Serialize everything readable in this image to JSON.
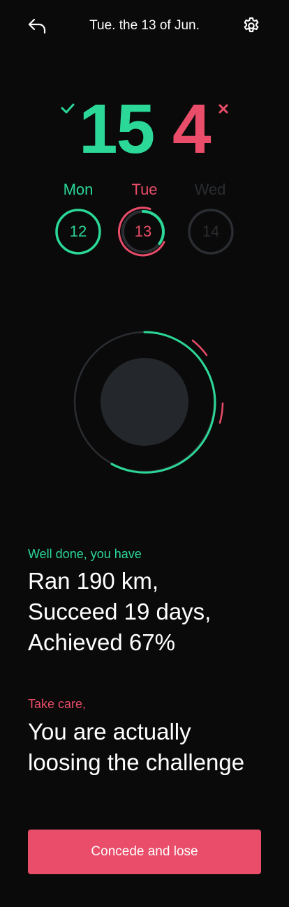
{
  "header": {
    "title": "Tue. the 13 of Jun.",
    "back_icon": "undo-arrow-icon",
    "settings_icon": "gear-icon"
  },
  "score": {
    "success_count": "15",
    "fail_count": "4",
    "success_icon": "check-icon",
    "fail_icon": "close-icon"
  },
  "days": [
    {
      "label": "Mon",
      "number": "12",
      "state": "success"
    },
    {
      "label": "Tue",
      "number": "13",
      "state": "current-failing"
    },
    {
      "label": "Wed",
      "number": "14",
      "state": "upcoming"
    }
  ],
  "messages": {
    "success_label": "Well done, you have",
    "success_lines": [
      "Ran 190 km,",
      "Succeed 19 days,",
      "Achieved 67%"
    ],
    "warning_label": "Take care,",
    "warning_lines": [
      "You are actually",
      "loosing the challenge"
    ]
  },
  "cta": {
    "label": "Concede and lose"
  },
  "colors": {
    "background": "#0a0a0a",
    "success": "#2bd898",
    "danger": "#e94d69",
    "muted": "#2a2d31",
    "center_disc": "#24272b",
    "text": "#ffffff"
  }
}
